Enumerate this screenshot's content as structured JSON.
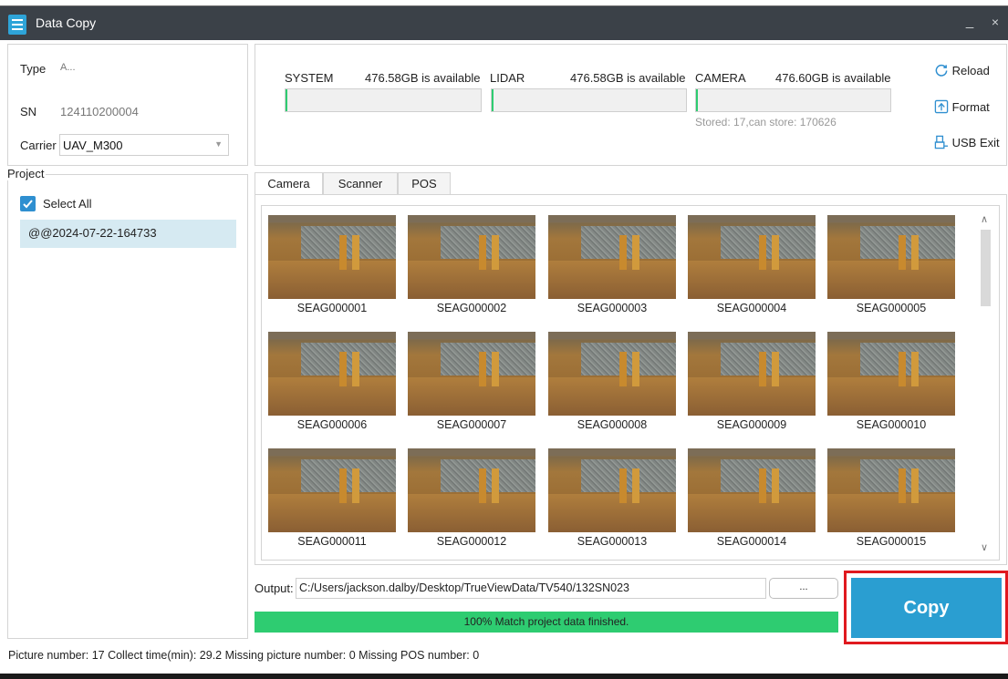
{
  "window": {
    "title": "Data Copy",
    "minimize": "_",
    "close": "×"
  },
  "device": {
    "type_label": "Type",
    "type_value": "A...",
    "sn_label": "SN",
    "sn_value": "124110200004",
    "carrier_label": "Carrier",
    "carrier_value": "UAV_M300"
  },
  "storage": {
    "system_label": "SYSTEM",
    "system_avail": "476.58GB is available",
    "lidar_label": "LIDAR",
    "lidar_avail": "476.58GB is available",
    "camera_label": "CAMERA",
    "camera_avail": "476.60GB is available",
    "camera_stored": "Stored: 17,can store: 170626"
  },
  "actions": {
    "reload": "Reload",
    "format": "Format",
    "usb_exit": "USB Exit"
  },
  "project": {
    "label": "Project",
    "select_all": "Select All",
    "items": [
      "@@2024-07-22-164733"
    ]
  },
  "tabs": [
    "Camera",
    "Scanner",
    "POS"
  ],
  "thumbnails": [
    "SEAG000001",
    "SEAG000002",
    "SEAG000003",
    "SEAG000004",
    "SEAG000005",
    "SEAG000006",
    "SEAG000007",
    "SEAG000008",
    "SEAG000009",
    "SEAG000010",
    "SEAG000011",
    "SEAG000012",
    "SEAG000013",
    "SEAG000014",
    "SEAG000015"
  ],
  "output": {
    "label": "Output:",
    "path": "C:/Users/jackson.dalby/Desktop/TrueViewData/TV540/132SN023",
    "browse": "..."
  },
  "progress": {
    "percent": 100,
    "text": "100% Match project data finished."
  },
  "copy_button": "Copy",
  "status": "Picture number: 17   Collect time(min): 29.2   Missing picture number: 0   Missing POS number: 0",
  "colors": {
    "accent": "#2a9ed1",
    "progress": "#2ecc71",
    "highlight": "#e0191f",
    "titlebar": "#3b4148"
  }
}
